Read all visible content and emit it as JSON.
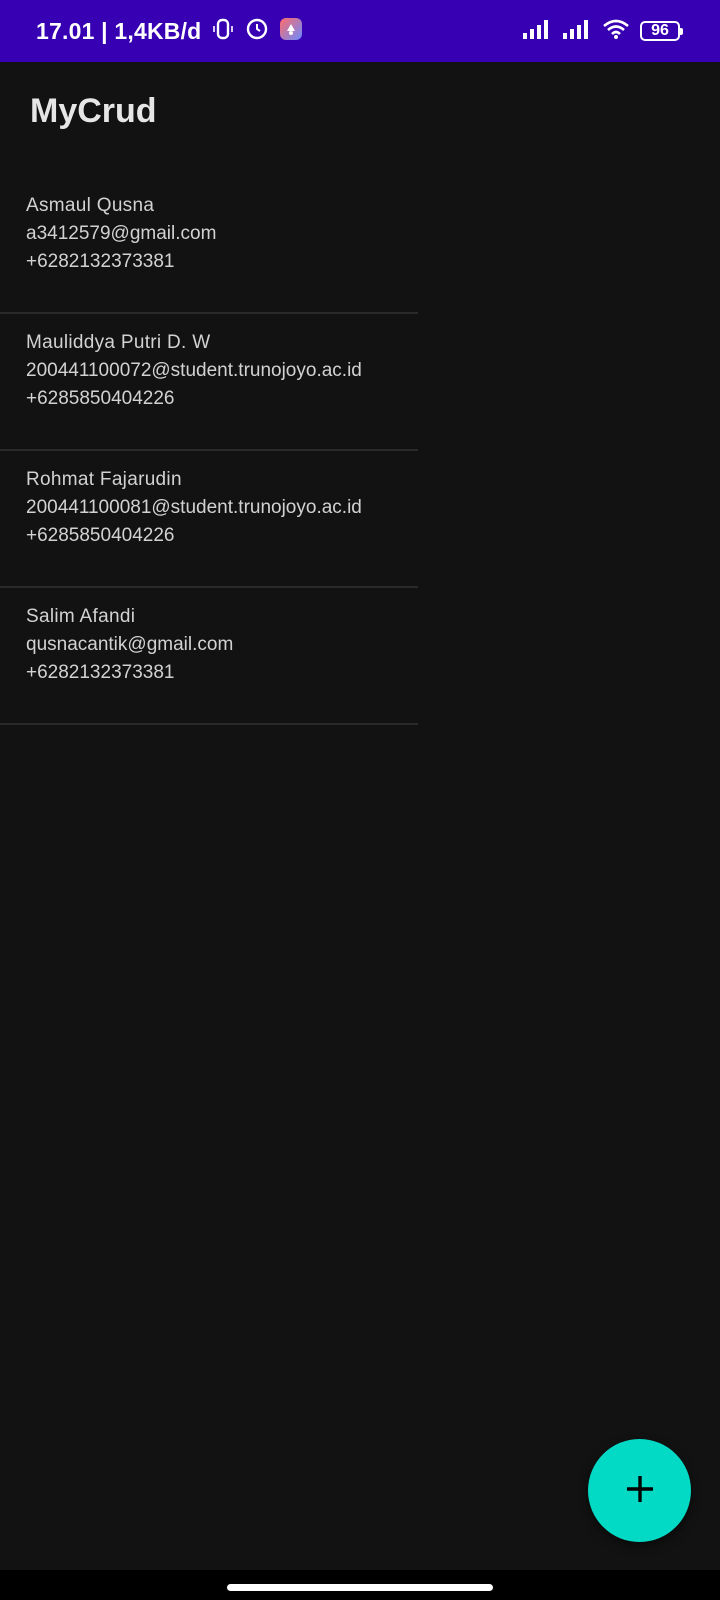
{
  "status_bar": {
    "time_and_speed": "17.01 | 1,4KB/d",
    "battery_level": "96",
    "icons": [
      "vibrate-icon",
      "alarm-icon",
      "app-notification-icon",
      "signal-icon",
      "signal-icon",
      "wifi-icon",
      "battery-icon"
    ]
  },
  "app": {
    "title": "MyCrud"
  },
  "contacts": [
    {
      "name": "Asmaul Qusna",
      "email": "a3412579@gmail.com",
      "phone": "+6282132373381"
    },
    {
      "name": "Mauliddya Putri D. W",
      "email": "200441100072@student.trunojoyo.ac.id",
      "phone": "+6285850404226"
    },
    {
      "name": "Rohmat Fajarudin",
      "email": "200441100081@student.trunojoyo.ac.id",
      "phone": "+6285850404226"
    },
    {
      "name": "Salim Afandi",
      "email": "qusnacantik@gmail.com",
      "phone": "+6282132373381"
    }
  ],
  "fab": {
    "icon": "plus-icon",
    "color": "#03dac5"
  },
  "colors": {
    "status_bar": "#3700b3",
    "background": "#121212",
    "text": "#d2d2d2"
  }
}
